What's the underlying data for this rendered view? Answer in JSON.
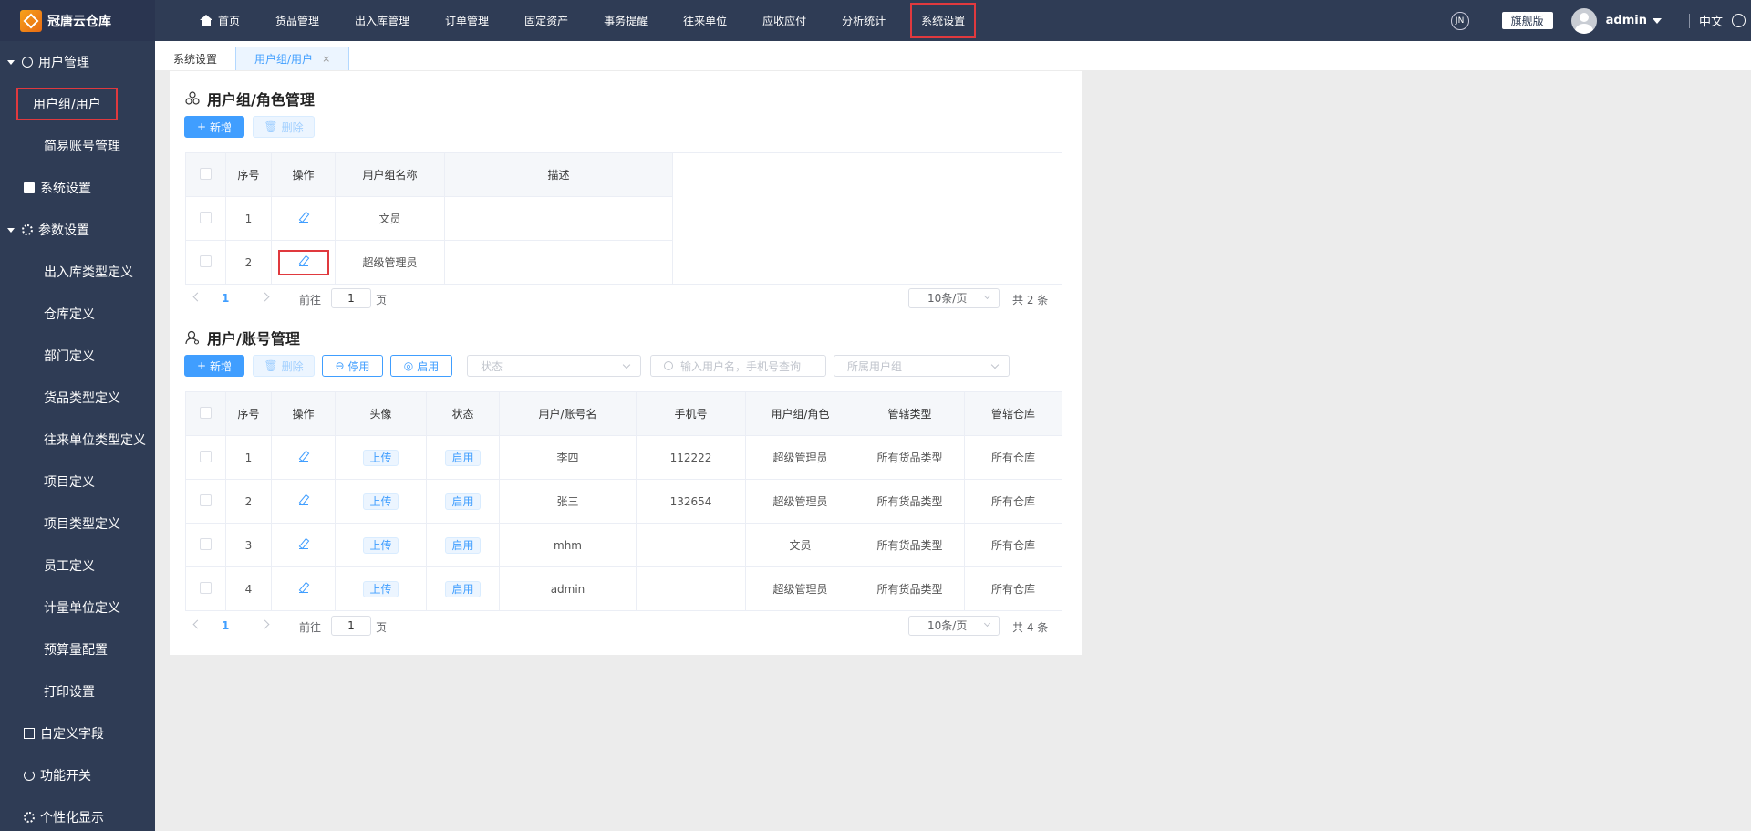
{
  "app": {
    "title": "冠唐云仓库"
  },
  "nav": {
    "items": [
      {
        "label": "首页"
      },
      {
        "label": "货品管理"
      },
      {
        "label": "出入库管理"
      },
      {
        "label": "订单管理"
      },
      {
        "label": "固定资产"
      },
      {
        "label": "事务提醒"
      },
      {
        "label": "往来单位"
      },
      {
        "label": "应收应付"
      },
      {
        "label": "分析统计"
      },
      {
        "label": "系统设置"
      }
    ],
    "active_index": 9
  },
  "topright": {
    "edition": "旗舰版",
    "user": "admin",
    "lang": "中文",
    "circle_icon_text": "JN"
  },
  "sidebar": {
    "user_mgmt": "用户管理",
    "user_group_user": "用户组/用户",
    "simple_account": "简易账号管理",
    "system_settings": "系统设置",
    "param_settings": "参数设置",
    "params": [
      "出入库类型定义",
      "仓库定义",
      "部门定义",
      "货品类型定义",
      "往来单位类型定义",
      "项目定义",
      "项目类型定义",
      "员工定义",
      "计量单位定义",
      "预算量配置",
      "打印设置"
    ],
    "custom_fields": "自定义字段",
    "feature_switch": "功能开关",
    "personalize": "个性化显示"
  },
  "tabs": [
    {
      "label": "系统设置"
    },
    {
      "label": "用户组/用户",
      "close": "×"
    }
  ],
  "groups_section": {
    "title": "用户组/角色管理",
    "add": "新增",
    "delete": "删除",
    "columns": [
      "序号",
      "操作",
      "用户组名称",
      "描述"
    ],
    "rows": [
      {
        "no": "1",
        "name": "文员",
        "desc": ""
      },
      {
        "no": "2",
        "name": "超级管理员",
        "desc": ""
      }
    ],
    "pager": {
      "page": "1",
      "goto": "前往",
      "input": "1",
      "page_unit": "页",
      "size": "10条/页",
      "total": "共 2 条"
    }
  },
  "users_section": {
    "title": "用户/账号管理",
    "add": "新增",
    "delete": "删除",
    "disable": "停用",
    "enable": "启用",
    "status_placeholder": "状态",
    "search_placeholder": "输入用户名，手机号查询",
    "group_placeholder": "所属用户组",
    "columns": [
      "序号",
      "操作",
      "头像",
      "状态",
      "用户/账号名",
      "手机号",
      "用户组/角色",
      "管辖类型",
      "管辖仓库"
    ],
    "rows": [
      {
        "no": "1",
        "avatar": "上传",
        "status": "启用",
        "name": "李四",
        "phone": "112222",
        "role": "超级管理员",
        "type": "所有货品类型",
        "wh": "所有仓库"
      },
      {
        "no": "2",
        "avatar": "上传",
        "status": "启用",
        "name": "张三",
        "phone": "132654",
        "role": "超级管理员",
        "type": "所有货品类型",
        "wh": "所有仓库"
      },
      {
        "no": "3",
        "avatar": "上传",
        "status": "启用",
        "name": "mhm",
        "phone": "",
        "role": "文员",
        "type": "所有货品类型",
        "wh": "所有仓库"
      },
      {
        "no": "4",
        "avatar": "上传",
        "status": "启用",
        "name": "admin",
        "phone": "",
        "role": "超级管理员",
        "type": "所有货品类型",
        "wh": "所有仓库"
      }
    ],
    "pager": {
      "page": "1",
      "goto": "前往",
      "input": "1",
      "page_unit": "页",
      "size": "10条/页",
      "total": "共 4 条"
    }
  },
  "colors": {
    "nav_bg": "#2f3c55",
    "accent": "#409eff",
    "highlight": "#e0393e"
  }
}
